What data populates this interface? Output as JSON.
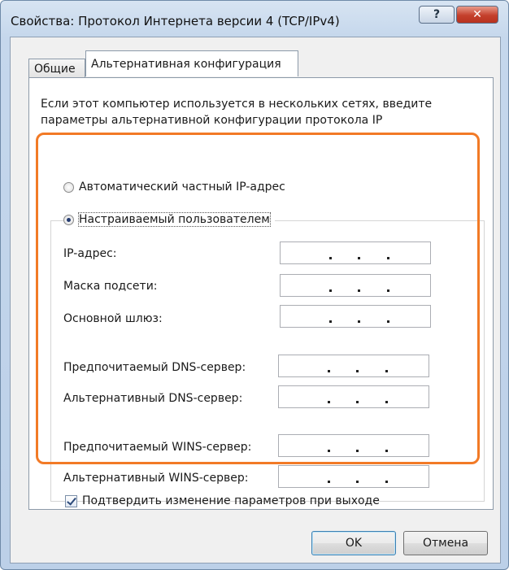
{
  "window": {
    "title": "Свойства: Протокол Интернета версии 4 (TCP/IPv4)",
    "help_label": "?",
    "close_label": "✕"
  },
  "tabs": [
    {
      "label": "Общие",
      "active": false
    },
    {
      "label": "Альтернативная конфигурация",
      "active": true
    }
  ],
  "description": "Если этот компьютер используется в нескольких сетях, введите параметры альтернативной конфигурации протокола IP",
  "radios": {
    "auto": {
      "label": "Автоматический частный IP-адрес",
      "checked": false
    },
    "manual": {
      "label": "Настраиваемый пользователем",
      "checked": true
    }
  },
  "fields": {
    "ip": {
      "label": "IP-адрес:",
      "value": ""
    },
    "mask": {
      "label": "Маска подсети:",
      "value": ""
    },
    "gateway": {
      "label": "Основной шлюз:",
      "value": ""
    },
    "dns1": {
      "label": "Предпочитаемый DNS-сервер:",
      "value": ""
    },
    "dns2": {
      "label": "Альтернативный DNS-сервер:",
      "value": ""
    },
    "wins1": {
      "label": "Предпочитаемый WINS-сервер:",
      "value": ""
    },
    "wins2": {
      "label": "Альтернативный WINS-сервер:",
      "value": ""
    }
  },
  "confirm_checkbox": {
    "label": "Подтвердить изменение параметров при выходе",
    "checked": true
  },
  "buttons": {
    "ok": "OK",
    "cancel": "Отмена"
  },
  "colors": {
    "highlight": "#f27a26",
    "close_button": "#c4402c"
  }
}
